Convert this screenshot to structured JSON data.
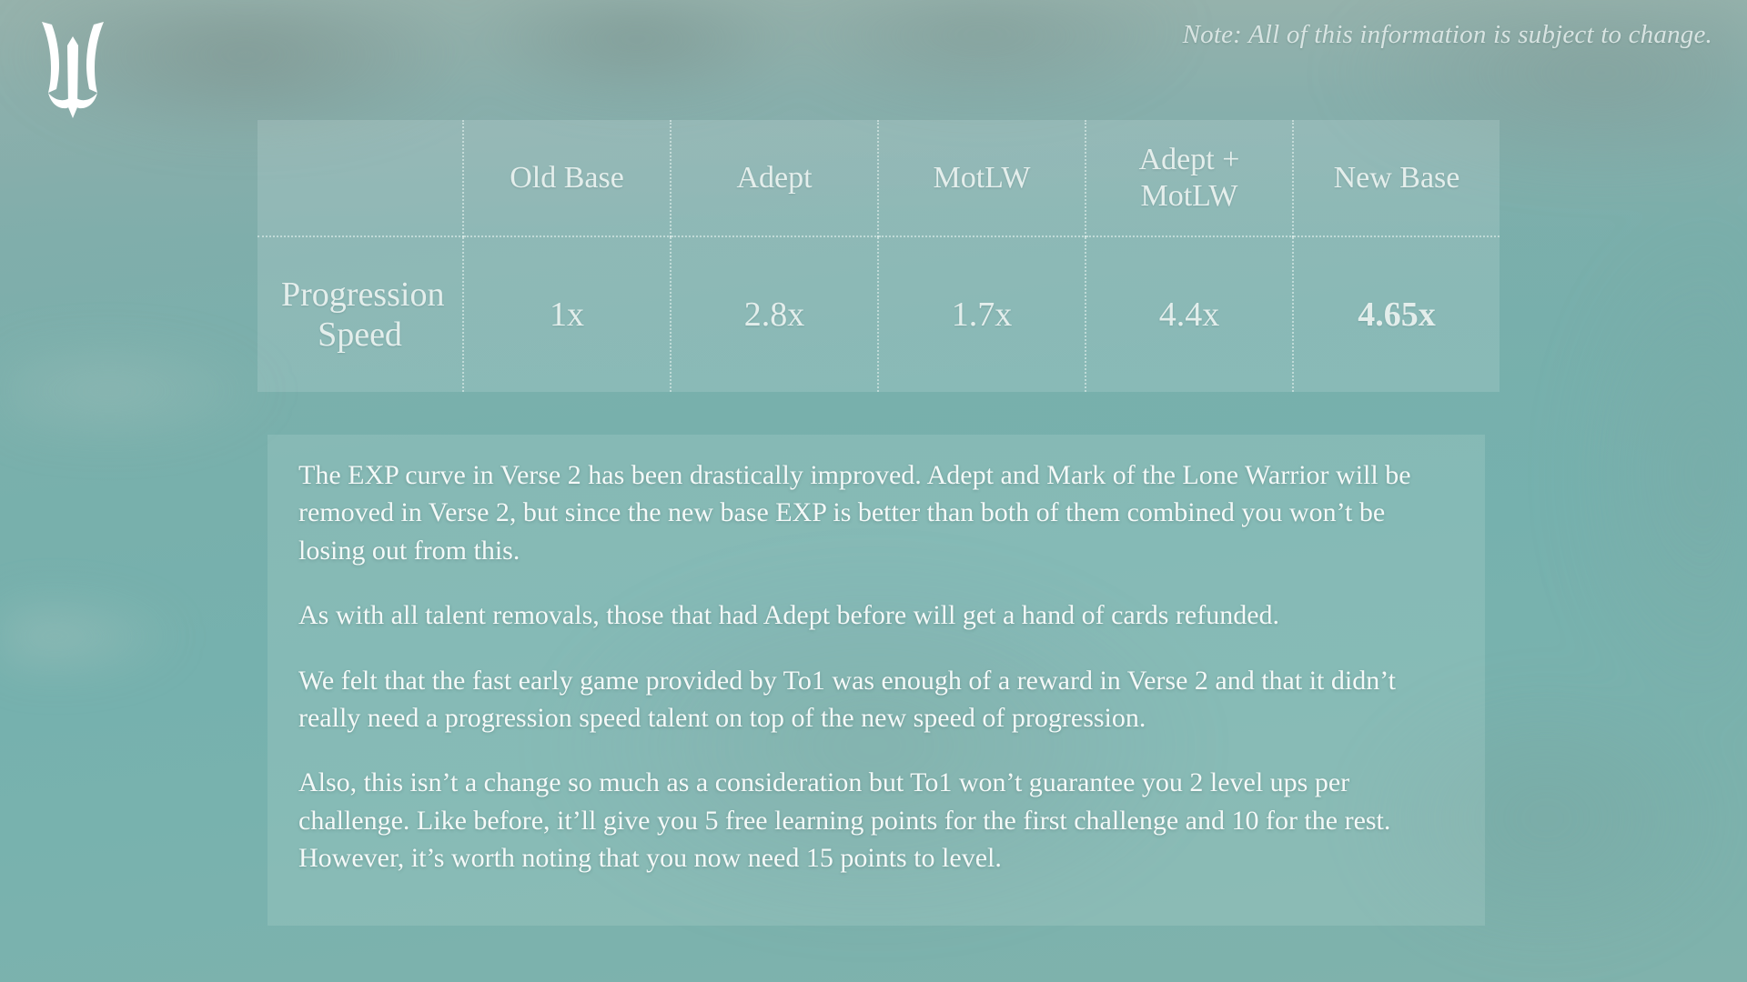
{
  "header": {
    "logo_alt": "trident-logo",
    "note": "Note: All of this information is subject to change."
  },
  "table": {
    "corner_label": "",
    "columns": [
      "Old Base",
      "Adept",
      "MotLW",
      "Adept + MotLW",
      "New Base"
    ],
    "rows": [
      {
        "label": "Progression Speed",
        "values": [
          "1x",
          "2.8x",
          "1.7x",
          "4.4x",
          "4.65x"
        ],
        "highlight_index": 4
      }
    ]
  },
  "notes": {
    "paragraphs": [
      "The EXP curve in Verse 2 has been drastically improved. Adept and Mark of the Lone Warrior will be removed in Verse 2, but since the new base EXP is better than both of them combined you won’t be losing out from this.",
      "As with all talent removals, those that had Adept before will get a hand of cards refunded.",
      "We felt that the fast early game provided by To1 was enough of a reward in Verse 2 and that it didn’t really need a progression speed talent on top of the new speed of progression.",
      "Also, this isn’t a change so much as a consideration but To1 won’t guarantee you 2 level ups per challenge. Like before, it’ll give you 5 free learning points for the first challenge and 10 for the rest. However, it’s worth noting that you now need 15 points to level."
    ]
  },
  "colors": {
    "background_teal": "#7db0ac",
    "panel_overlay": "rgba(208,230,226,0.17)",
    "text_primary": "#f4f9f8",
    "text_muted": "rgba(238,245,243,0.90)",
    "divider": "rgba(235,245,243,0.55)",
    "highlight": "#ffffff"
  }
}
